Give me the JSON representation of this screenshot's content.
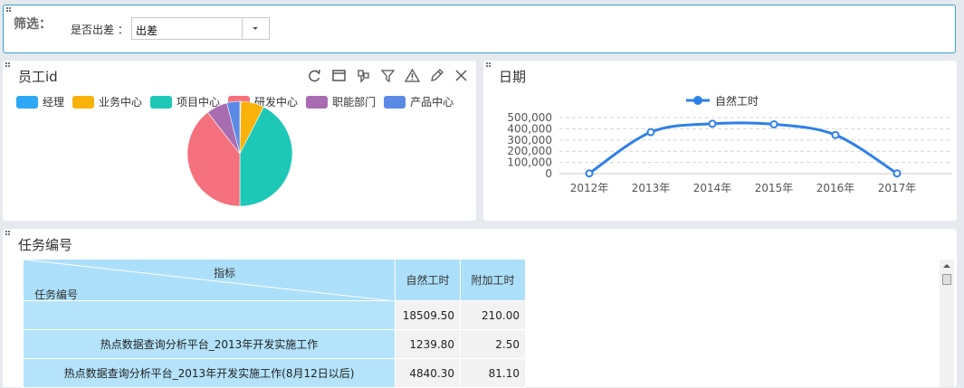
{
  "filter": {
    "title": "筛选：",
    "field_label": "是否出差 ：",
    "selected": "出差"
  },
  "pie_panel": {
    "title": "员工id",
    "tools": [
      "refresh-icon",
      "maximize-icon",
      "drill-icon",
      "filter-icon",
      "warning-icon",
      "edit-icon",
      "close-icon"
    ],
    "legend": [
      {
        "label": "经理",
        "color": "#2ea7f5"
      },
      {
        "label": "业务中心",
        "color": "#f9b20a"
      },
      {
        "label": "项目中心",
        "color": "#1dc8b6"
      },
      {
        "label": "研发中心",
        "color": "#f4717d"
      },
      {
        "label": "职能部门",
        "color": "#a86cb0"
      },
      {
        "label": "产品中心",
        "color": "#5b8ae6"
      }
    ],
    "chart_data": {
      "type": "pie",
      "categories": [
        "经理",
        "业务中心",
        "项目中心",
        "研发中心",
        "职能部门",
        "产品中心"
      ],
      "values": [
        0.3,
        7.2,
        42.5,
        39.5,
        6.5,
        4.0
      ],
      "colors": [
        "#2ea7f5",
        "#f9b20a",
        "#1dc8b6",
        "#f4717d",
        "#a86cb0",
        "#5b8ae6"
      ]
    }
  },
  "line_panel": {
    "title": "日期",
    "chart_data": {
      "type": "line",
      "categories": [
        "2012年",
        "2013年",
        "2014年",
        "2015年",
        "2016年",
        "2017年"
      ],
      "series": [
        {
          "name": "自然工时",
          "values": [
            2000,
            370000,
            445000,
            440000,
            345000,
            2000
          ],
          "color": "#2f80e8"
        }
      ],
      "yticks": [
        "500,000",
        "400,000",
        "300,000",
        "200,000",
        "100,000",
        "0"
      ],
      "ylim": [
        0,
        500000
      ],
      "grid": true,
      "legend": "top-center"
    }
  },
  "table_panel": {
    "title": "任务编号",
    "header": {
      "indicator": "指标",
      "row_dim": "任务编号",
      "col1": "自然工时",
      "col2": "附加工时"
    },
    "rows": [
      {
        "name": "",
        "v1": "18509.50",
        "v2": "210.00"
      },
      {
        "name": "热点数据查询分析平台_2013年开发实施工作",
        "v1": "1239.80",
        "v2": "2.50"
      },
      {
        "name": "热点数据查询分析平台_2013年开发实施工作(8月12日以后)",
        "v1": "4840.30",
        "v2": "81.10"
      }
    ]
  }
}
